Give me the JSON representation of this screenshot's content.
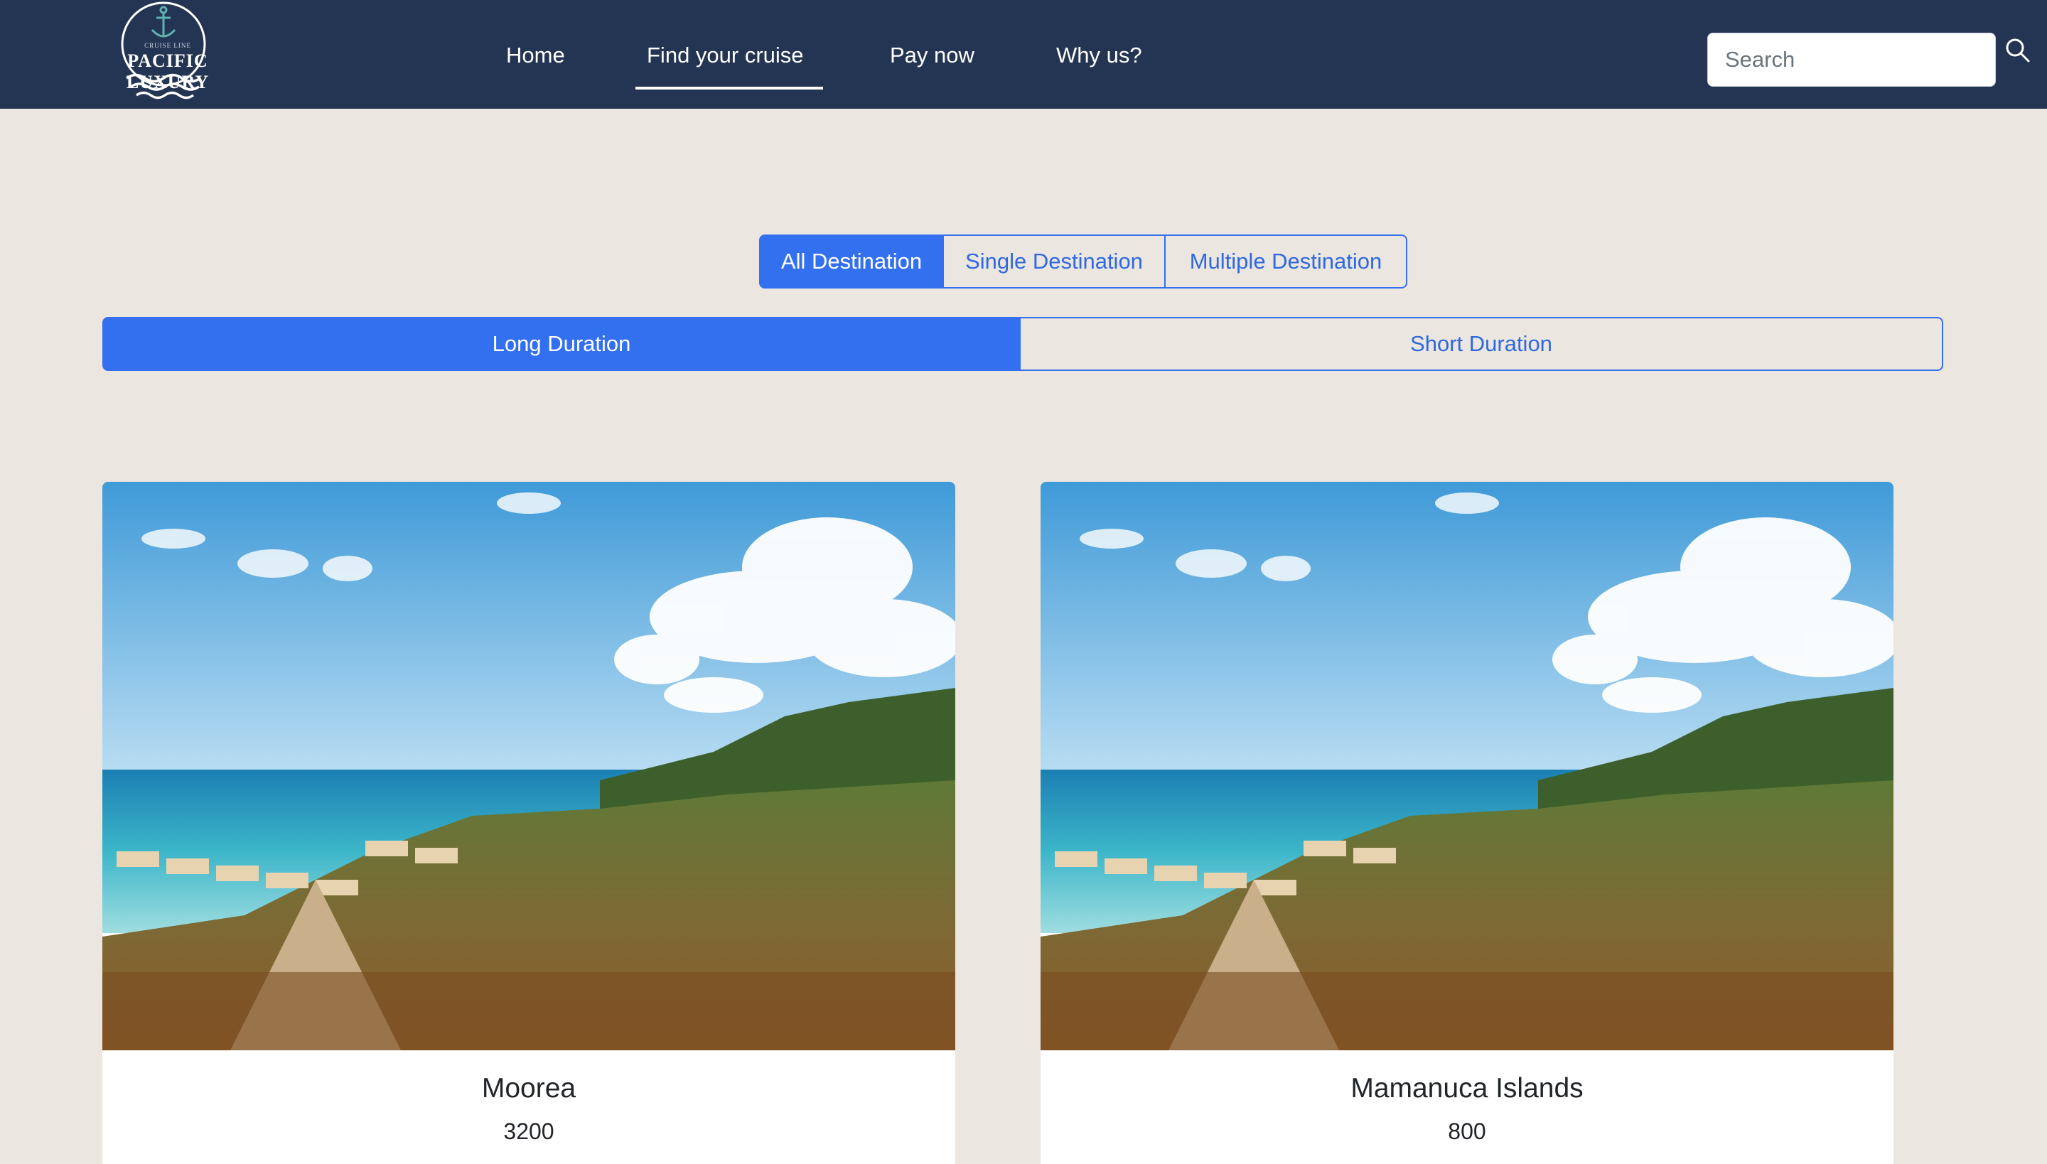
{
  "brand": {
    "name": "PACIFIC LUXURY",
    "tagline": "CRUISE LINE"
  },
  "nav": {
    "items": [
      {
        "label": "Home"
      },
      {
        "label": "Find your cruise",
        "active": true
      },
      {
        "label": "Pay now"
      },
      {
        "label": "Why us?"
      }
    ]
  },
  "search": {
    "placeholder": "Search",
    "icon": "search-icon"
  },
  "destination_filter": {
    "options": [
      "All Destination",
      "Single Destination",
      "Multiple Destination"
    ],
    "selected": "All Destination"
  },
  "duration_filter": {
    "options": [
      "Long Duration",
      "Short Duration"
    ],
    "selected": "Long Duration"
  },
  "cruises": [
    {
      "name": "Moorea",
      "price": "3200"
    },
    {
      "name": "Mamanuca Islands",
      "price": "800"
    }
  ],
  "colors": {
    "navbar": "#243553",
    "page_background": "#ebe6e0",
    "primary": "#3370f0"
  }
}
